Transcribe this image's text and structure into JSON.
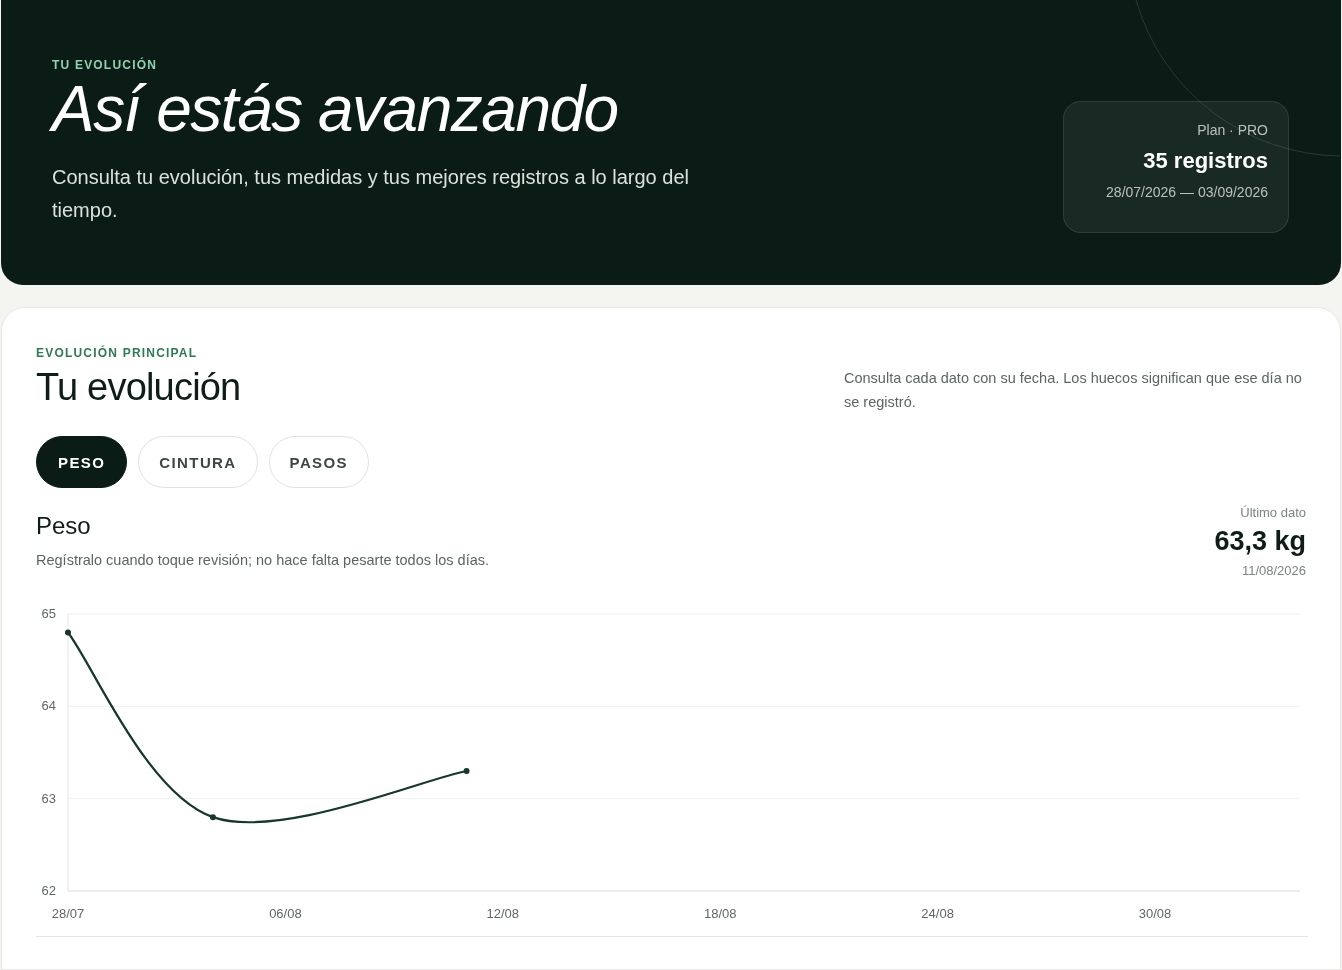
{
  "hero": {
    "eyebrow": "TU EVOLUCIÓN",
    "title": "Así estás avanzando",
    "subtitle": "Consulta tu evolución, tus medidas y tus mejores registros a lo largo del tiempo.",
    "summary": {
      "plan": "Plan · PRO",
      "count": "35 registros",
      "range": "28/07/2026 — 03/09/2026"
    }
  },
  "panel": {
    "eyebrow": "EVOLUCIÓN PRINCIPAL",
    "title": "Tu evolución",
    "note": "Consulta cada dato con su fecha. Los huecos significan que ese día no se registró.",
    "tabs": [
      {
        "label": "PESO",
        "selected": true
      },
      {
        "label": "CINTURA",
        "selected": false
      },
      {
        "label": "PASOS",
        "selected": false
      }
    ],
    "metric": {
      "title": "Peso",
      "description": "Regístralo cuando toque revisión; no hace falta pesarte todos los días.",
      "last_label": "Último dato",
      "last_value": "63,3 kg",
      "last_date": "11/08/2026"
    },
    "chart_data": {
      "type": "line",
      "categories": [
        "28/07",
        null,
        null,
        null,
        null,
        null,
        "06/08",
        null,
        null,
        null,
        null,
        null,
        "12/08",
        null,
        null,
        null,
        null,
        null,
        "18/08",
        null,
        null,
        null,
        null,
        null,
        "24/08",
        null,
        null,
        null,
        null,
        null,
        "30/08",
        null,
        null,
        null,
        null
      ],
      "series": [
        {
          "color": "#16372a",
          "marker": "circle",
          "values": [
            64.8,
            null,
            null,
            null,
            62.8,
            null,
            null,
            null,
            null,
            null,
            null,
            63.3,
            null,
            null,
            null,
            null,
            null,
            null,
            null,
            null,
            null,
            null,
            null,
            null,
            null,
            null,
            null,
            null,
            null,
            null,
            null,
            null,
            null,
            null,
            null
          ]
        }
      ],
      "ylim": [
        62,
        65
      ],
      "yticks": [
        62,
        63,
        64,
        65
      ]
    }
  }
}
